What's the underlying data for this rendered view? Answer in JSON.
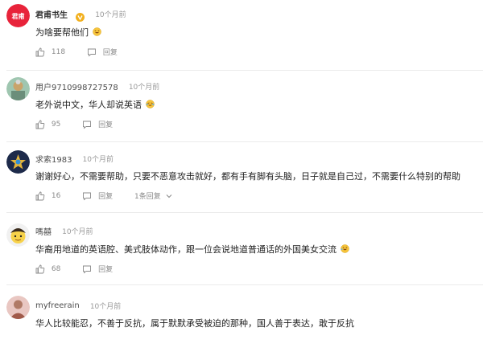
{
  "comments": [
    {
      "username": "君甫书生",
      "avatar_text": "君甫",
      "time": "10个月前",
      "text": "为啥要帮他们",
      "likes": "118",
      "reply_label": "回复"
    },
    {
      "username": "用户9710998727578",
      "time": "10个月前",
      "text": "老外说中文，华人却说英语",
      "likes": "95",
      "reply_label": "回复"
    },
    {
      "username": "求索1983",
      "time": "10个月前",
      "text": "谢谢好心，不需要帮助，只要不恶意攻击就好，都有手有脚有头脑，日子就是自己过，不需要什么特别的帮助",
      "likes": "16",
      "reply_label": "回复",
      "replies_label": "1条回复"
    },
    {
      "username": "嗎囍",
      "time": "10个月前",
      "text": "华裔用地道的英语腔、美式肢体动作，跟一位会说地道普通话的外国美女交流",
      "likes": "68",
      "reply_label": "回复"
    },
    {
      "username": "myfreerain",
      "time": "10个月前",
      "text": "华人比较能忍，不善于反抗，属于默默承受被迫的那种，国人善于表达，敢于反抗"
    }
  ],
  "colors": {
    "brand_red": "#e8233a",
    "verified_gold": "#f2b01e",
    "muted": "#999999"
  }
}
